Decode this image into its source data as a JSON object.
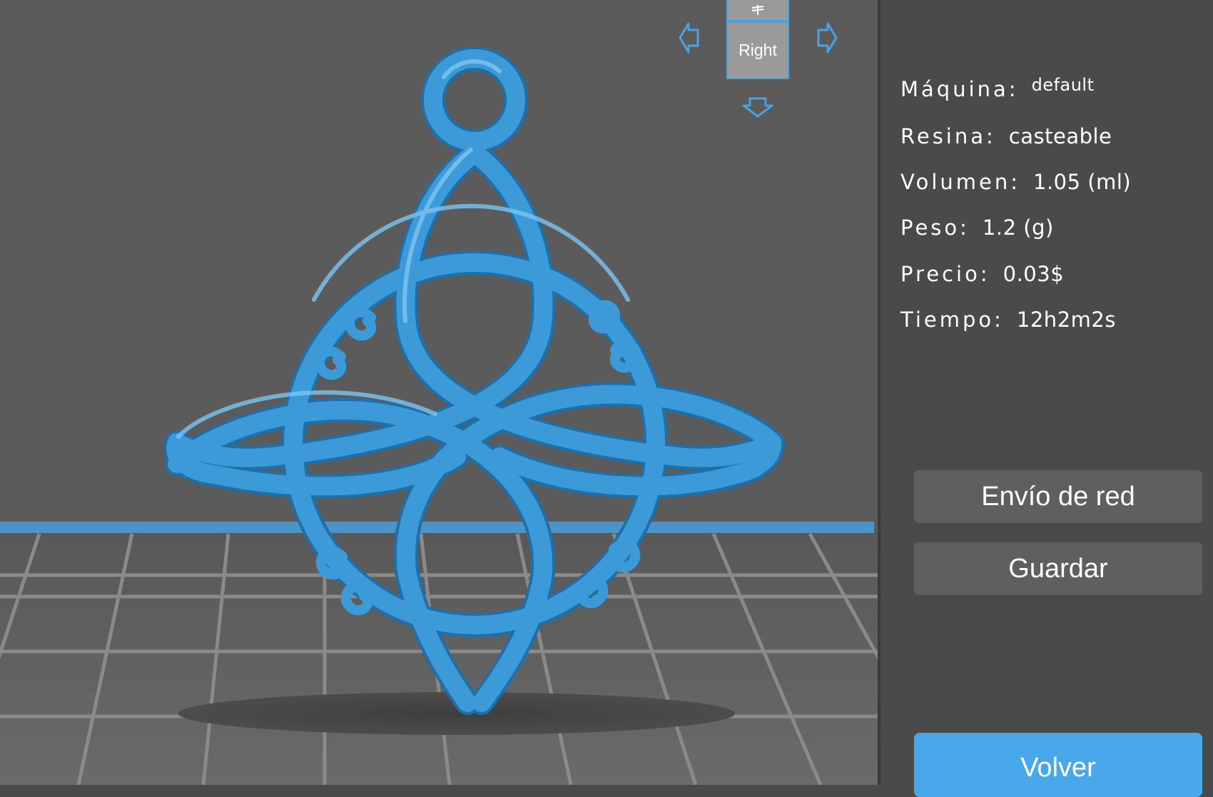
{
  "view_cube": {
    "face_label": "Right"
  },
  "info": {
    "machine_label": "Máquina:",
    "machine_value": "default",
    "resin_label": "Resina:",
    "resin_value": "casteable",
    "volume_label": "Volumen:",
    "volume_value": "1.05 (ml)",
    "weight_label": "Peso:",
    "weight_value": "1.2 (g)",
    "price_label": "Precio:",
    "price_value": "0.03$",
    "time_label": "Tiempo:",
    "time_value": "12h2m2s"
  },
  "buttons": {
    "network_send": "Envío de red",
    "save": "Guardar",
    "back": "Volver"
  },
  "colors": {
    "model": "#3d9ad8",
    "accent": "#49a8ea",
    "viewport_bg": "#5b5b5b",
    "panel_bg": "#4a4a4a"
  }
}
